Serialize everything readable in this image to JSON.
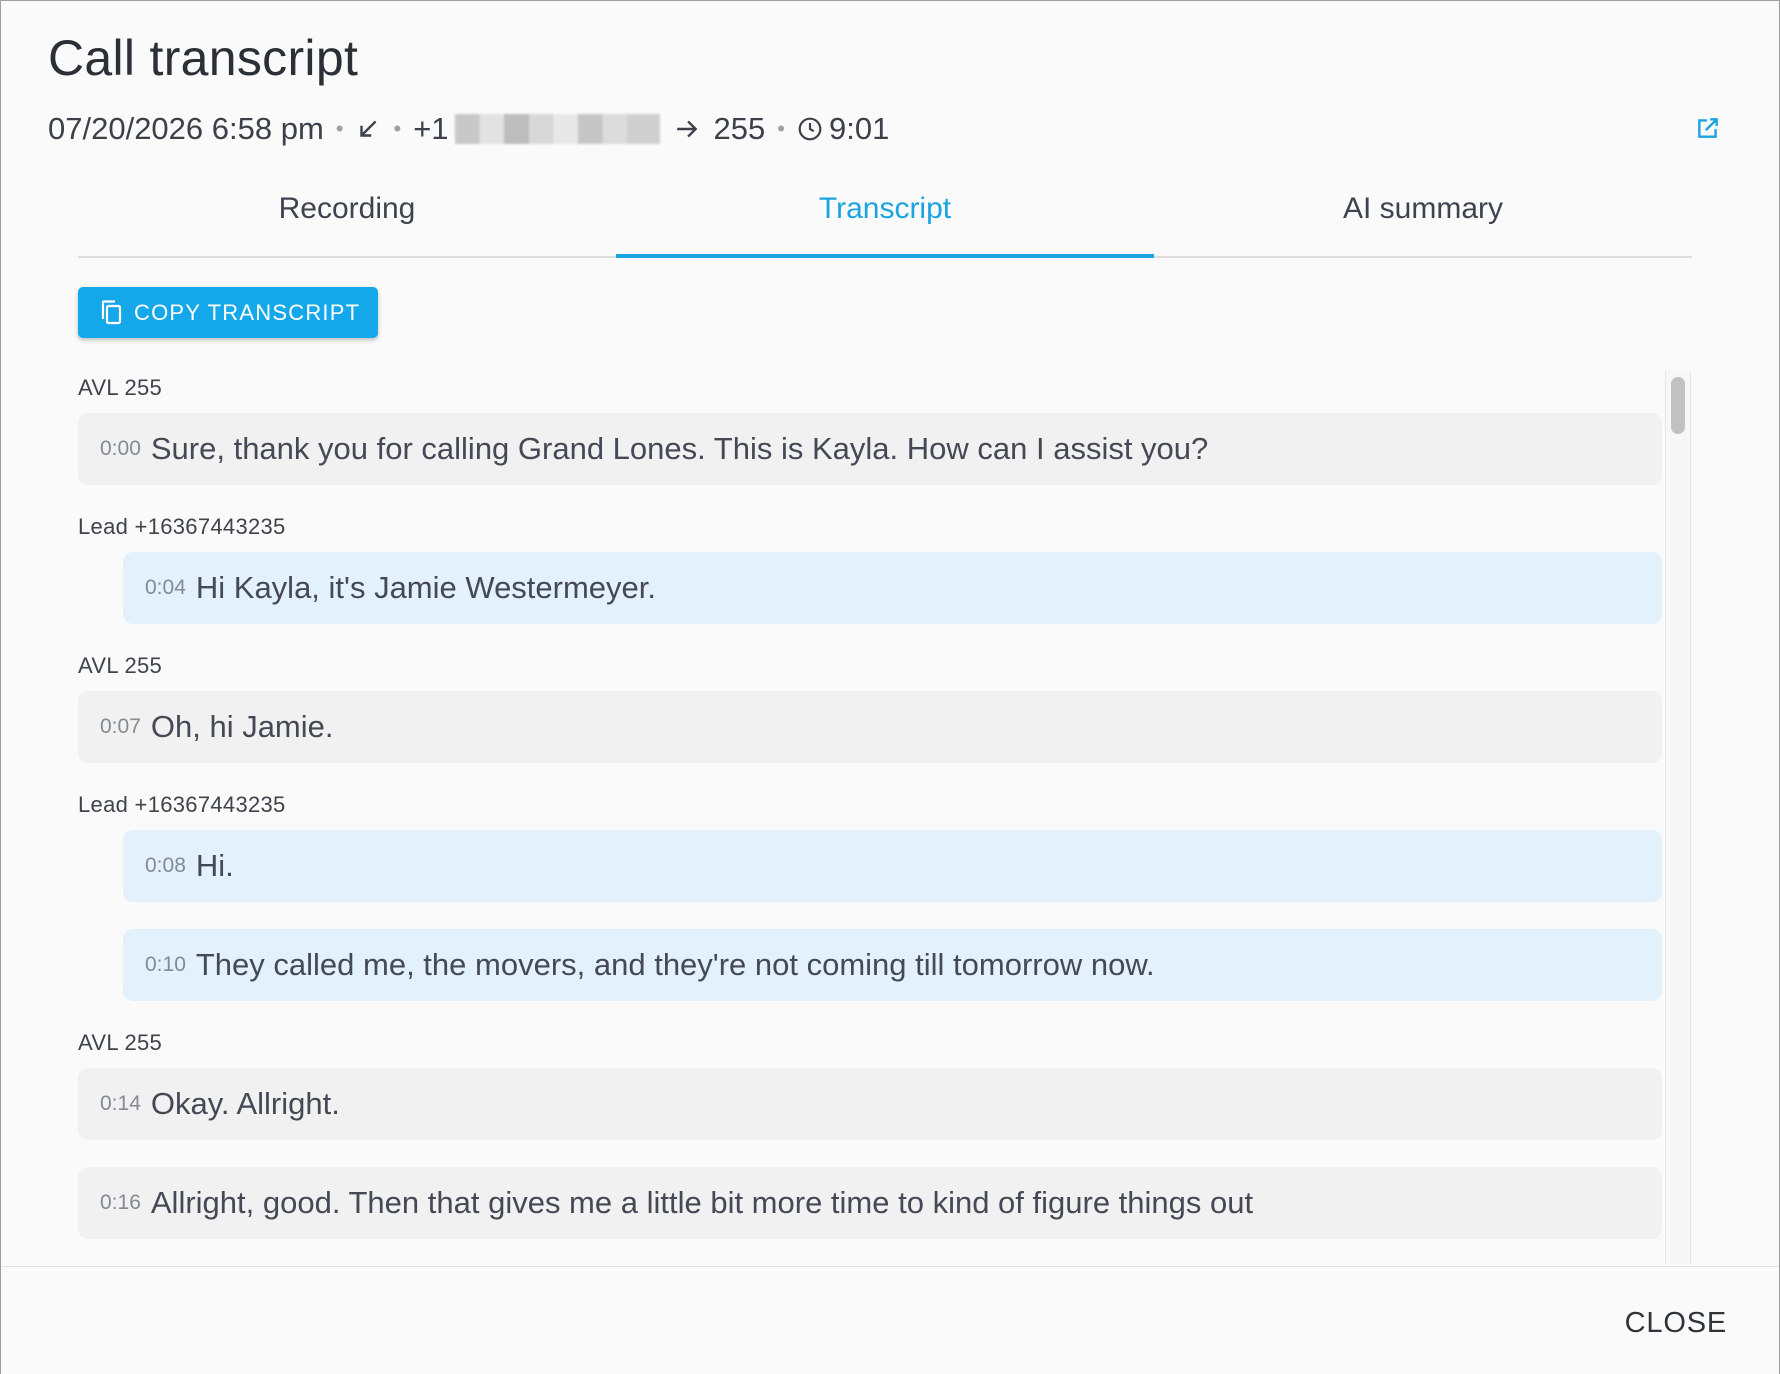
{
  "dialog": {
    "title": "Call transcript",
    "meta": {
      "datetime": "07/20/2026 6:58 pm",
      "direction_icon": "incoming-call-arrow-icon",
      "from_prefix": "+1",
      "to_icon": "arrow-right-icon",
      "to": "255",
      "duration_icon": "clock-icon",
      "duration": "9:01"
    },
    "open_external_icon": "open-in-new-icon"
  },
  "tabs": [
    {
      "label": "Recording",
      "active": false
    },
    {
      "label": "Transcript",
      "active": true
    },
    {
      "label": "AI summary",
      "active": false
    }
  ],
  "copy_button": {
    "label": "COPY TRANSCRIPT",
    "icon": "copy-icon"
  },
  "transcript": [
    {
      "speaker": "AVL 255",
      "role": "agent",
      "lines": [
        {
          "time": "0:00",
          "text": "Sure, thank you for calling Grand Lones. This is Kayla. How can I assist you?"
        }
      ]
    },
    {
      "speaker": "Lead +16367443235",
      "role": "lead",
      "lines": [
        {
          "time": "0:04",
          "text": "Hi Kayla, it's Jamie Westermeyer."
        }
      ]
    },
    {
      "speaker": "AVL 255",
      "role": "agent",
      "lines": [
        {
          "time": "0:07",
          "text": "Oh, hi Jamie."
        }
      ]
    },
    {
      "speaker": "Lead +16367443235",
      "role": "lead",
      "lines": [
        {
          "time": "0:08",
          "text": "Hi."
        },
        {
          "time": "0:10",
          "text": "They called me, the movers, and they're not coming till tomorrow now."
        }
      ]
    },
    {
      "speaker": "AVL 255",
      "role": "agent",
      "lines": [
        {
          "time": "0:14",
          "text": "Okay. Allright."
        },
        {
          "time": "0:16",
          "text": "Allright, good. Then that gives me a little bit more time to kind of figure things out"
        }
      ]
    }
  ],
  "footer": {
    "close_label": "CLOSE"
  },
  "colors": {
    "accent": "#14a8ea",
    "lead_bubble": "#e2f1fc",
    "agent_bubble": "#f1f1f1"
  }
}
